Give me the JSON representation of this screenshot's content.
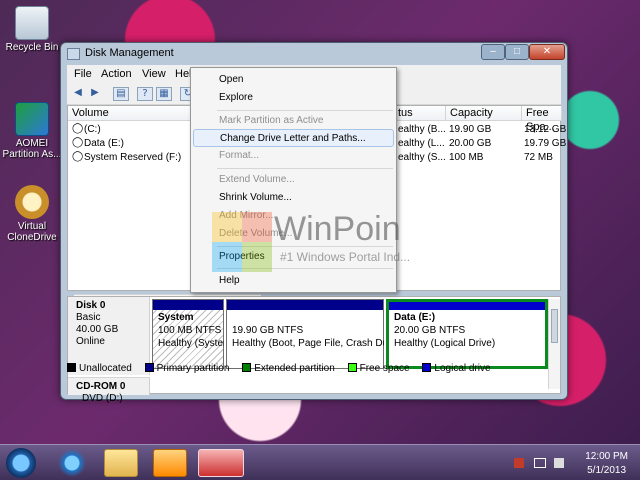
{
  "desktop": {
    "icons": [
      {
        "label": "Recycle Bin",
        "icon": "recycle-bin-icon"
      },
      {
        "label": "AOMEI Partition As...",
        "icon": "aomei-icon"
      },
      {
        "label": "Virtual CloneDrive",
        "icon": "clonedrive-icon"
      }
    ]
  },
  "window": {
    "title": "Disk Management",
    "controls": {
      "minimize": "–",
      "maximize": "□",
      "close": "✕"
    },
    "menu": [
      "File",
      "Action",
      "View",
      "Help"
    ],
    "toolbar": [
      "back-icon",
      "forward-icon",
      "console-tree-icon",
      "help-icon",
      "properties-icon",
      "refresh-icon"
    ]
  },
  "volume_list": {
    "columns": [
      "Volume",
      "",
      "",
      "",
      "tus",
      "Capacity",
      "Free Spa..."
    ],
    "rows": [
      {
        "volume": "(C:)",
        "status": "ealthy (B...",
        "capacity": "19.90 GB",
        "free": "13.12 GB"
      },
      {
        "volume": "Data (E:)",
        "status": "ealthy (L...",
        "capacity": "20.00 GB",
        "free": "19.79 GB"
      },
      {
        "volume": "System Reserved (F:)",
        "status": "ealthy (S...",
        "capacity": "100 MB",
        "free": "72 MB"
      }
    ]
  },
  "disks": [
    {
      "name": "Disk 0",
      "type": "Basic",
      "size": "40.00 GB",
      "state": "Online",
      "partitions": [
        {
          "name": "System",
          "size": "100 MB NTFS",
          "status": "Healthy (Syster"
        },
        {
          "name": "",
          "size": "19.90 GB NTFS",
          "status": "Healthy (Boot, Page File, Crash Dur"
        },
        {
          "name": "Data  (E:)",
          "size": "20.00 GB NTFS",
          "status": "Healthy (Logical Drive)"
        }
      ]
    },
    {
      "name": "CD-ROM 0",
      "type": "DVD (D:)",
      "size": "",
      "state": ""
    }
  ],
  "legend": [
    {
      "label": "Unallocated",
      "color": "#000000"
    },
    {
      "label": "Primary partition",
      "color": "#00008b"
    },
    {
      "label": "Extended partition",
      "color": "#008000"
    },
    {
      "label": "Free space",
      "color": "#39ff14"
    },
    {
      "label": "Logical drive",
      "color": "#0000cd"
    }
  ],
  "context_menu": {
    "items": [
      {
        "label": "Open",
        "enabled": true
      },
      {
        "label": "Explore",
        "enabled": true
      },
      {
        "label": "Mark Partition as Active",
        "enabled": false
      },
      {
        "label": "Change Drive Letter and Paths...",
        "enabled": true,
        "highlighted": true
      },
      {
        "label": "Format...",
        "enabled": false
      },
      {
        "label": "Extend Volume...",
        "enabled": false
      },
      {
        "label": "Shrink Volume...",
        "enabled": true
      },
      {
        "label": "Add Mirror...",
        "enabled": false
      },
      {
        "label": "Delete Volume...",
        "enabled": false
      },
      {
        "label": "Properties",
        "enabled": true
      },
      {
        "label": "Help",
        "enabled": true
      }
    ]
  },
  "watermark": {
    "title": "WinPoin",
    "subtitle": "#1 Windows Portal Ind..."
  },
  "taskbar": {
    "apps": [
      "start-orb-icon",
      "internet-explorer-icon",
      "windows-explorer-icon",
      "media-player-icon",
      "disk-management-icon"
    ],
    "time": "12:00 PM",
    "date": "5/1/2013"
  }
}
